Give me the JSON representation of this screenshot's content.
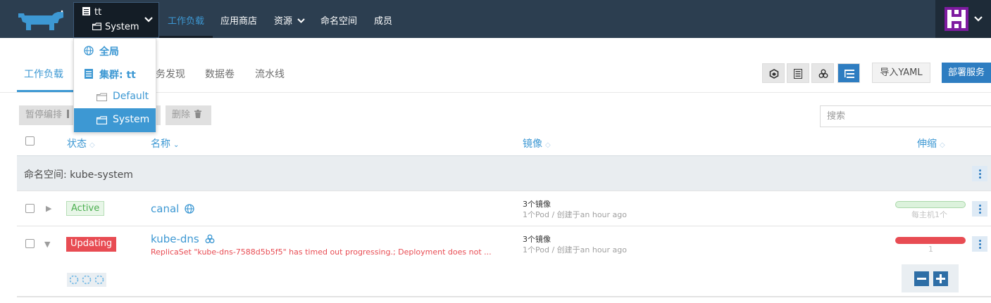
{
  "topnav": {
    "context": {
      "cluster": "tt",
      "project": "System"
    },
    "items": [
      "工作负载",
      "应用商店",
      "资源",
      "命名空间",
      "成员"
    ],
    "active_index": 0
  },
  "context_menu": {
    "global": "全局",
    "cluster": "集群: tt",
    "projects": [
      "Default",
      "System"
    ],
    "selected": "System"
  },
  "subnav": {
    "tabs": [
      "工作负载",
      "务发现",
      "数据卷",
      "流水线"
    ],
    "active_index": 0
  },
  "toolbar": {
    "import_yaml": "导入YAML",
    "deploy": "部署服务"
  },
  "bulk_actions": {
    "pause": "暂停编排",
    "delete": "删除"
  },
  "search": {
    "placeholder": "搜索"
  },
  "table": {
    "headers": {
      "state": "状态",
      "name": "名称",
      "image": "镜像",
      "scale": "伸缩"
    },
    "group_label": "命名空间: kube-system",
    "rows": [
      {
        "state": "Active",
        "name": "canal",
        "image_count": "3个镜像",
        "image_detail": "1个Pod / 创建于an hour ago",
        "scale_label": "每主机1个"
      },
      {
        "state": "Updating",
        "name": "kube-dns",
        "error": "ReplicaSet \"kube-dns-7588d5b5f5\" has timed out progressing.; Deployment does not ...",
        "image_count": "3个镜像",
        "image_detail": "1个Pod / 创建于an hour ago",
        "scale_label": "1"
      }
    ]
  },
  "colors": {
    "topbar": "#2c3e50",
    "accent": "#3d98d3",
    "primary_button": "#2e7dc1",
    "active_state": "#4caf50",
    "updating_state": "#e84c53"
  }
}
